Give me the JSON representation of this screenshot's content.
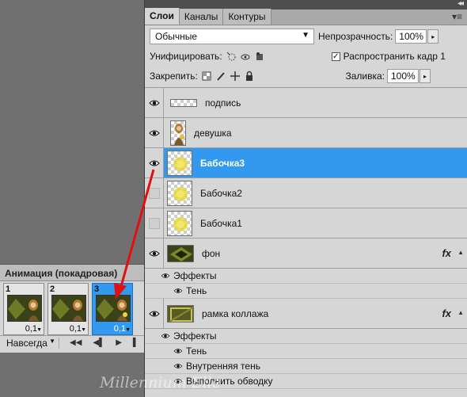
{
  "tabs": [
    {
      "label": "Слои",
      "active": true
    },
    {
      "label": "Каналы",
      "active": false
    },
    {
      "label": "Контуры",
      "active": false
    }
  ],
  "blend_mode": "Обычные",
  "opacity_label": "Непрозрачность:",
  "opacity_value": "100%",
  "unify_label": "Унифицировать:",
  "propagate_label": "Распространить кадр 1",
  "propagate_checked": true,
  "lock_label": "Закрепить:",
  "fill_label": "Заливка:",
  "fill_value": "100%",
  "layers": [
    {
      "name": "подпись",
      "visible": true,
      "selected": false
    },
    {
      "name": "девушка",
      "visible": true,
      "selected": false
    },
    {
      "name": "Бабочка3",
      "visible": true,
      "selected": true
    },
    {
      "name": "Бабочка2",
      "visible": false,
      "selected": false
    },
    {
      "name": "Бабочка1",
      "visible": false,
      "selected": false
    },
    {
      "name": "фон",
      "visible": true,
      "selected": false,
      "fx": "fx",
      "effects_label": "Эффекты",
      "effects": [
        "Тень"
      ]
    },
    {
      "name": "рамка коллажа",
      "visible": true,
      "selected": false,
      "fx": "fx",
      "effects_label": "Эффекты",
      "effects": [
        "Тень",
        "Внутренняя тень",
        "Выполнить обводку"
      ]
    }
  ],
  "animation": {
    "title": "Анимация (покадровая)",
    "frames": [
      {
        "num": "1",
        "delay": "0,1",
        "selected": false
      },
      {
        "num": "2",
        "delay": "0,1",
        "selected": false
      },
      {
        "num": "3",
        "delay": "0,1",
        "selected": true
      }
    ],
    "loop": "Навсегда"
  },
  "watermark": "Millennium Elle",
  "colors": {
    "selection": "#3399ee",
    "arrow": "#e01010"
  }
}
